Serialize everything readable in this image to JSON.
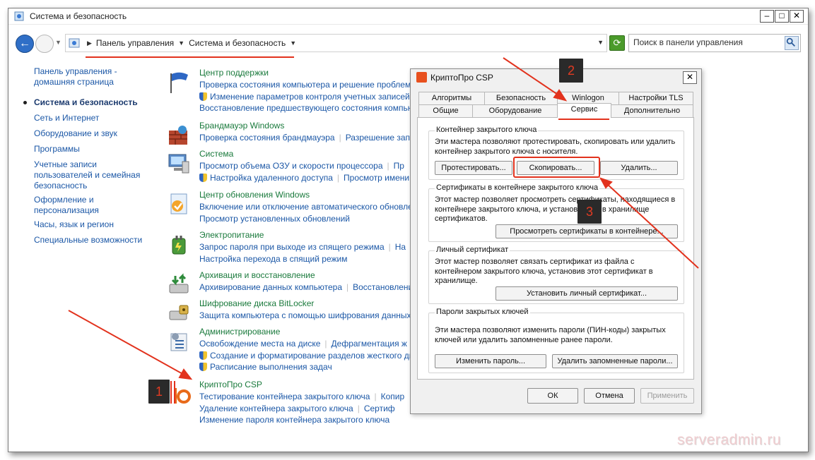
{
  "window": {
    "title": "Система и безопасность"
  },
  "toolbar": {
    "crumbs": [
      "Панель управления",
      "Система и безопасность"
    ],
    "search_placeholder": "Поиск в панели управления"
  },
  "leftnav": {
    "items": [
      "Панель управления - домашняя страница",
      "Система и безопасность",
      "Сеть и Интернет",
      "Оборудование и звук",
      "Программы",
      "Учетные записи пользователей и семейная безопасность",
      "Оформление и персонализация",
      "Часы, язык и регион",
      "Специальные возможности"
    ]
  },
  "categories": [
    {
      "title": "Центр поддержки",
      "lines": [
        [
          "Проверка состояния компьютера и решение проблем"
        ],
        [
          "Изменение параметров контроля учетных записей"
        ],
        [
          "Восстановление предшествующего состояния компьютера"
        ]
      ]
    },
    {
      "title": "Брандмауэр Windows",
      "lines": [
        [
          "Проверка состояния брандмауэра",
          "Разрешение запуска"
        ]
      ]
    },
    {
      "title": "Система",
      "lines": [
        [
          "Просмотр объема ОЗУ и скорости процессора",
          "Пр"
        ],
        [
          "Настройка удаленного доступа",
          "Просмотр имени"
        ]
      ]
    },
    {
      "title": "Центр обновления Windows",
      "lines": [
        [
          "Включение или отключение автоматического обновления"
        ],
        [
          "Просмотр установленных обновлений"
        ]
      ]
    },
    {
      "title": "Электропитание",
      "lines": [
        [
          "Запрос пароля при выходе из спящего режима",
          "На"
        ],
        [
          "Настройка перехода в спящий режим"
        ]
      ]
    },
    {
      "title": "Архивация и восстановление",
      "lines": [
        [
          "Архивирование данных компьютера",
          "Восстановление"
        ]
      ]
    },
    {
      "title": "Шифрование диска BitLocker",
      "lines": [
        [
          "Защита компьютера с помощью шифрования данных"
        ]
      ]
    },
    {
      "title": "Администрирование",
      "lines": [
        [
          "Освобождение места на диске",
          "Дефрагментация ж"
        ],
        [
          "Создание и форматирование разделов жесткого ди"
        ],
        [
          "Расписание выполнения задач"
        ]
      ]
    },
    {
      "title": "КриптоПро CSP",
      "lines": [
        [
          "Тестирование контейнера закрытого ключа",
          "Копир"
        ],
        [
          "Удаление контейнера закрытого ключа",
          "Сертиф"
        ],
        [
          "Изменение пароля контейнера закрытого ключа"
        ]
      ]
    }
  ],
  "dialog": {
    "title": "КриптоПро CSP",
    "tabs_row1": [
      "Алгоритмы",
      "Безопасность",
      "Winlogon",
      "Настройки TLS"
    ],
    "tabs_row2": [
      "Общие",
      "Оборудование",
      "Сервис",
      "Дополнительно"
    ],
    "groups": {
      "container": {
        "title": "Контейнер закрытого ключа",
        "desc": "Эти мастера позволяют протестировать, скопировать или удалить контейнер закрытого ключа с носителя.",
        "btn_test": "Протестировать...",
        "btn_copy": "Скопировать...",
        "btn_delete": "Удалить..."
      },
      "certs": {
        "title": "Сертификаты в контейнере закрытого ключа",
        "desc": "Этот мастер позволяет просмотреть сертификаты, находящиеся в контейнере закрытого ключа, и установить их в хранилище сертификатов.",
        "btn_view": "Просмотреть сертификаты в контейнере..."
      },
      "personal": {
        "title": "Личный сертификат",
        "desc": "Этот мастер позволяет связать сертификат из файла с контейнером закрытого ключа, установив этот сертификат в хранилище.",
        "btn_install": "Установить личный сертификат..."
      },
      "passwords": {
        "title": "Пароли закрытых ключей",
        "desc": "Эти мастера позволяют изменить пароли (ПИН-коды) закрытых ключей или удалить запомненные ранее пароли.",
        "btn_change": "Изменить пароль...",
        "btn_remove": "Удалить запомненные пароли..."
      }
    },
    "footer": {
      "ok": "ОК",
      "cancel": "Отмена",
      "apply": "Применить"
    }
  },
  "markers": [
    "1",
    "2",
    "3"
  ],
  "watermark": "serveradmin.ru",
  "colors": {
    "accent_red": "#e2321d",
    "link_blue": "#1b57a6",
    "category_green": "#1a7a3c"
  }
}
